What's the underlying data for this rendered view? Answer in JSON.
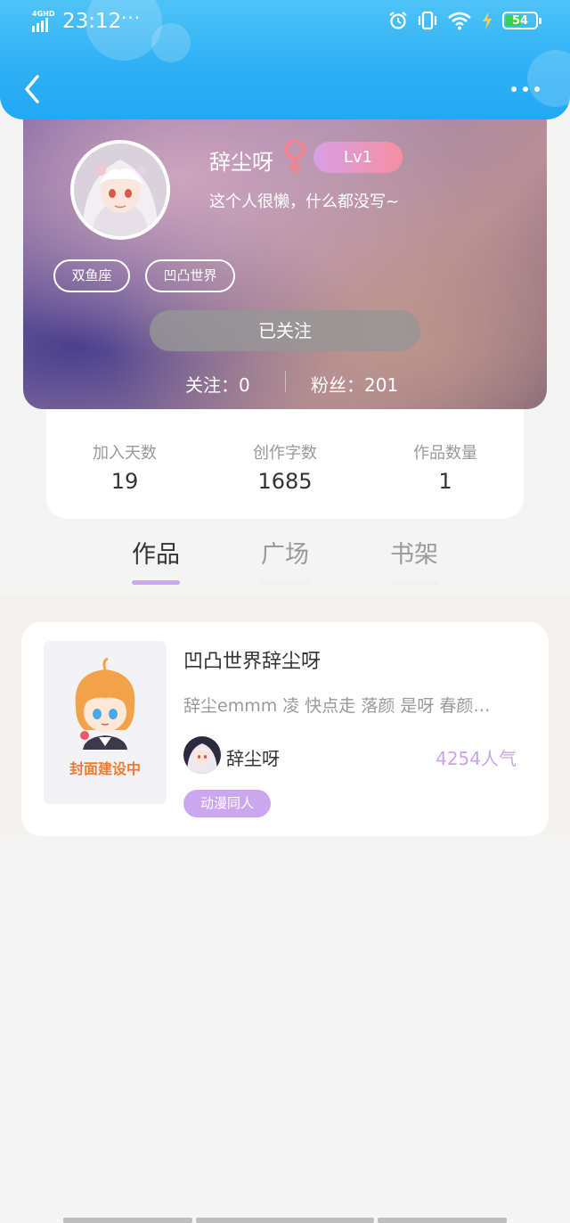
{
  "status_bar": {
    "network": "4GHD",
    "time": "23:12",
    "overflow": "···",
    "battery": "54",
    "battery_level": 0.54,
    "icons": [
      "alarm-icon",
      "vibrate-icon",
      "wifi-icon",
      "charging-icon",
      "battery-icon"
    ]
  },
  "header": {
    "back_icon": "chevron-left-icon",
    "more_icon": "more-dots-icon"
  },
  "profile": {
    "name": "辞尘呀",
    "gender_icon": "female-symbol-icon",
    "level": "Lv1",
    "bio": "这个人很懒，什么都没写~",
    "tags": [
      "双鱼座",
      "凹凸世界"
    ],
    "follow_button": "已关注",
    "following": "关注：0",
    "fans": "粉丝：201"
  },
  "stats": [
    {
      "label": "加入天数",
      "value": "19"
    },
    {
      "label": "创作字数",
      "value": "1685"
    },
    {
      "label": "作品数量",
      "value": "1"
    }
  ],
  "tabs": [
    {
      "label": "作品",
      "active": true
    },
    {
      "label": "广场",
      "active": false
    },
    {
      "label": "书架",
      "active": false
    }
  ],
  "work": {
    "cover_text": "封面建设中",
    "title": "凹凸世界辞尘呀",
    "description": "辞尘emmm 凌 快点走 落颜 是呀 春颜…",
    "author": "辞尘呀",
    "popularity": "4254人气",
    "category": "动漫同人"
  },
  "colors": {
    "header_blue": "#2fb0f5",
    "accent_purple": "#c9a8f0",
    "level_gradient_start": "#d8a0e6",
    "level_gradient_end": "#f58fa0",
    "cover_text_orange": "#ef7a33",
    "gender_pink": "#f5818f"
  }
}
